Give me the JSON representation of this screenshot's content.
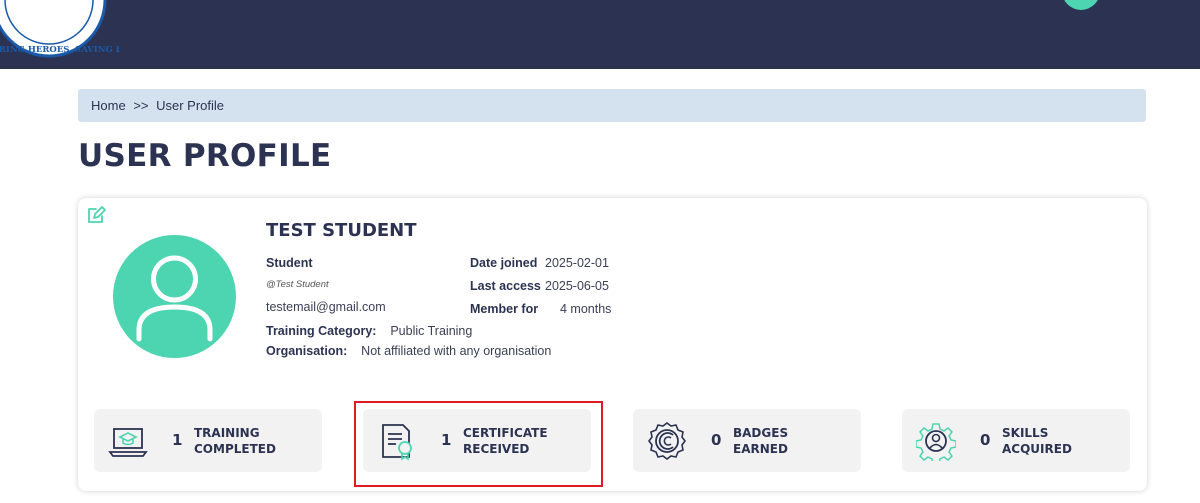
{
  "header": {
    "logo_text": "EMPOWERING HEROES, SAVING LIVES",
    "colors": {
      "bar": "#2c3352",
      "accent": "#4dd4b0"
    }
  },
  "breadcrumb": {
    "home": "Home",
    "separator": ">>",
    "current": "User Profile"
  },
  "page_title": "USER PROFILE",
  "profile": {
    "name": "TEST STUDENT",
    "role": "Student",
    "handle": "@Test Student",
    "email": "testemail@gmail.com",
    "training_category_label": "Training Category:",
    "training_category": "Public Training",
    "organisation_label": "Organisation:",
    "organisation": "Not affiliated with any organisation",
    "date_joined_label": "Date joined",
    "date_joined": "2025-02-01",
    "last_access_label": "Last access",
    "last_access": "2025-06-05",
    "member_for_label": "Member for",
    "member_for": "4 months"
  },
  "stats": [
    {
      "icon": "laptop-graduation-icon",
      "value": "1",
      "line1": "TRAINING",
      "line2": "COMPLETED"
    },
    {
      "icon": "certificate-icon",
      "value": "1",
      "line1": "CERTIFICATE",
      "line2": "RECEIVED"
    },
    {
      "icon": "badge-icon",
      "value": "0",
      "line1": "BADGES",
      "line2": "EARNED"
    },
    {
      "icon": "gear-user-icon",
      "value": "0",
      "line1": "SKILLS",
      "line2": "ACQUIRED"
    }
  ]
}
